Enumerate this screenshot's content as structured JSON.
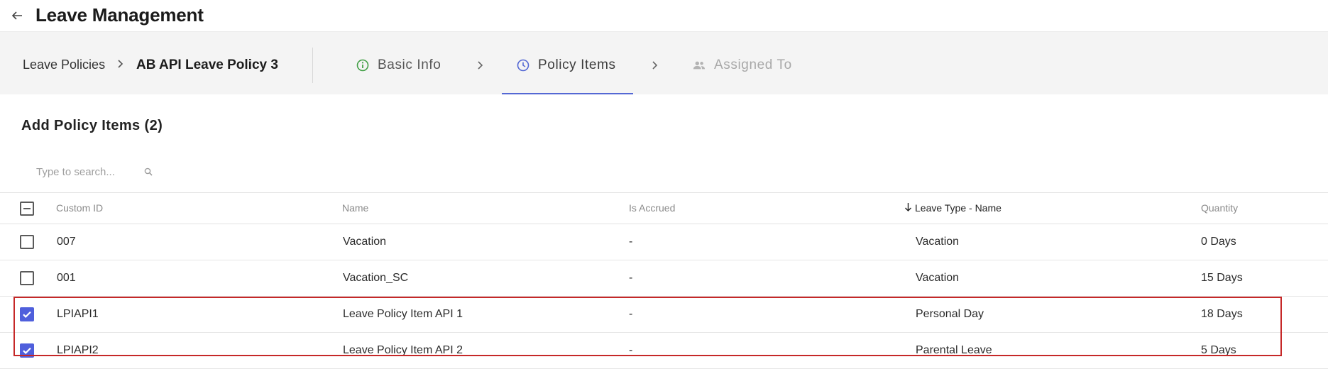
{
  "header": {
    "title": "Leave Management"
  },
  "breadcrumb": {
    "root": "Leave Policies",
    "current": "AB API Leave Policy 3"
  },
  "steps": [
    {
      "label": "Basic Info",
      "icon": "info-circle-icon",
      "status": "complete"
    },
    {
      "label": "Policy Items",
      "icon": "clock-icon",
      "status": "active"
    },
    {
      "label": "Assigned To",
      "icon": "people-icon",
      "status": "disabled"
    }
  ],
  "section": {
    "title": "Add Policy Items (2)"
  },
  "search": {
    "placeholder": "Type to search..."
  },
  "table": {
    "columns": [
      "Custom ID",
      "Name",
      "Is Accrued",
      "Leave Type - Name",
      "Quantity"
    ],
    "sorted_column": "Leave Type - Name",
    "sort_direction": "descending",
    "rows": [
      {
        "id": "007",
        "name": "Vacation",
        "accrued": "-",
        "type": "Vacation",
        "qty": "0 Days",
        "checked": false
      },
      {
        "id": "001",
        "name": "Vacation_SC",
        "accrued": "-",
        "type": "Vacation",
        "qty": "15 Days",
        "checked": false
      },
      {
        "id": "LPIAPI1",
        "name": "Leave Policy Item API 1",
        "accrued": "-",
        "type": "Personal Day",
        "qty": "18 Days",
        "checked": true
      },
      {
        "id": "LPIAPI2",
        "name": "Leave Policy Item API 2",
        "accrued": "-",
        "type": "Parental Leave",
        "qty": "5 Days",
        "checked": true
      }
    ]
  },
  "colors": {
    "accent": "#4f5fdc",
    "complete": "#43a047",
    "highlight": "#c62828"
  }
}
